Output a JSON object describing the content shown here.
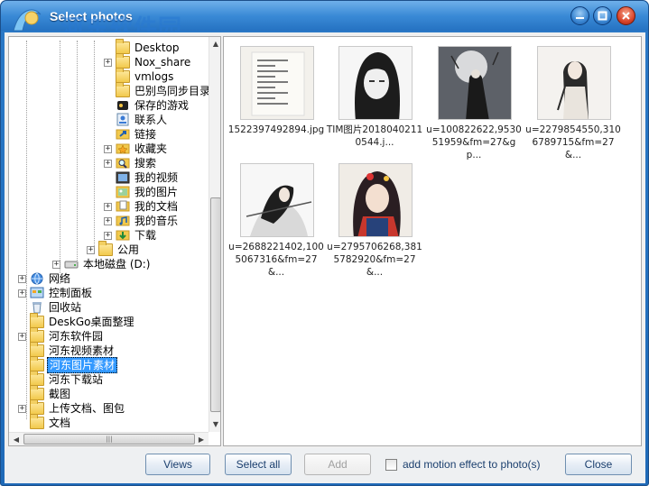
{
  "window": {
    "title": "Select photos",
    "watermark": "河东软件园",
    "watermark_url": "www.pc0359.cn"
  },
  "tree": {
    "items": [
      {
        "label": "Desktop",
        "icon": "folder-icon",
        "indent": 5,
        "expander": "none"
      },
      {
        "label": "Nox_share",
        "icon": "folder-icon",
        "indent": 5,
        "expander": "plus"
      },
      {
        "label": "vmlogs",
        "icon": "folder-icon",
        "indent": 5,
        "expander": "none"
      },
      {
        "label": "巴别鸟同步目录",
        "icon": "folder-icon",
        "indent": 5,
        "expander": "none"
      },
      {
        "label": "保存的游戏",
        "icon": "saved-games-icon",
        "indent": 5,
        "expander": "none"
      },
      {
        "label": "联系人",
        "icon": "contacts-icon",
        "indent": 5,
        "expander": "none"
      },
      {
        "label": "链接",
        "icon": "links-icon",
        "indent": 5,
        "expander": "none"
      },
      {
        "label": "收藏夹",
        "icon": "favorites-icon",
        "indent": 5,
        "expander": "plus"
      },
      {
        "label": "搜索",
        "icon": "search-folder-icon",
        "indent": 5,
        "expander": "plus"
      },
      {
        "label": "我的视频",
        "icon": "videos-icon",
        "indent": 5,
        "expander": "none"
      },
      {
        "label": "我的图片",
        "icon": "pictures-icon",
        "indent": 5,
        "expander": "none"
      },
      {
        "label": "我的文档",
        "icon": "documents-icon",
        "indent": 5,
        "expander": "plus"
      },
      {
        "label": "我的音乐",
        "icon": "music-icon",
        "indent": 5,
        "expander": "plus"
      },
      {
        "label": "下载",
        "icon": "downloads-icon",
        "indent": 5,
        "expander": "plus"
      },
      {
        "label": "公用",
        "icon": "folder-icon",
        "indent": 4,
        "expander": "plus"
      },
      {
        "label": "本地磁盘 (D:)",
        "icon": "drive-icon",
        "indent": 2,
        "expander": "plus"
      },
      {
        "label": "网络",
        "icon": "network-icon",
        "indent": 0,
        "expander": "plus"
      },
      {
        "label": "控制面板",
        "icon": "control-panel-icon",
        "indent": 0,
        "expander": "plus"
      },
      {
        "label": "回收站",
        "icon": "recycle-bin-icon",
        "indent": 0,
        "expander": "none"
      },
      {
        "label": "DeskGo桌面整理",
        "icon": "folder-icon",
        "indent": 0,
        "expander": "none"
      },
      {
        "label": "河东软件园",
        "icon": "folder-icon",
        "indent": 0,
        "expander": "plus"
      },
      {
        "label": "河东视频素材",
        "icon": "folder-icon",
        "indent": 0,
        "expander": "none"
      },
      {
        "label": "河东图片素材",
        "icon": "folder-icon",
        "indent": 0,
        "expander": "none",
        "selected": true
      },
      {
        "label": "河东下载站",
        "icon": "folder-icon",
        "indent": 0,
        "expander": "none"
      },
      {
        "label": "截图",
        "icon": "folder-icon",
        "indent": 0,
        "expander": "none"
      },
      {
        "label": "上传文档、图包",
        "icon": "folder-icon",
        "indent": 0,
        "expander": "plus"
      },
      {
        "label": "文档",
        "icon": "folder-icon",
        "indent": 0,
        "expander": "none"
      }
    ]
  },
  "photos": [
    {
      "caption": "1522397492894.jpg",
      "art": "document"
    },
    {
      "caption": "TIM图片20180402110544.j...",
      "art": "sketch"
    },
    {
      "caption": "u=100822622,953051959&fm=27&gp...",
      "art": "moon"
    },
    {
      "caption": "u=2279854550,3106789715&fm=27&...",
      "art": "robe"
    },
    {
      "caption": "u=2688221402,1005067316&fm=27&...",
      "art": "swordsman"
    },
    {
      "caption": "u=2795706268,3815782920&fm=27&...",
      "art": "colorful"
    }
  ],
  "footer": {
    "views_label": "Views",
    "select_all_label": "Select all",
    "add_label": "Add",
    "motion_checkbox_label": "add motion effect to photo(s)",
    "motion_checked": false,
    "close_label": "Close"
  }
}
